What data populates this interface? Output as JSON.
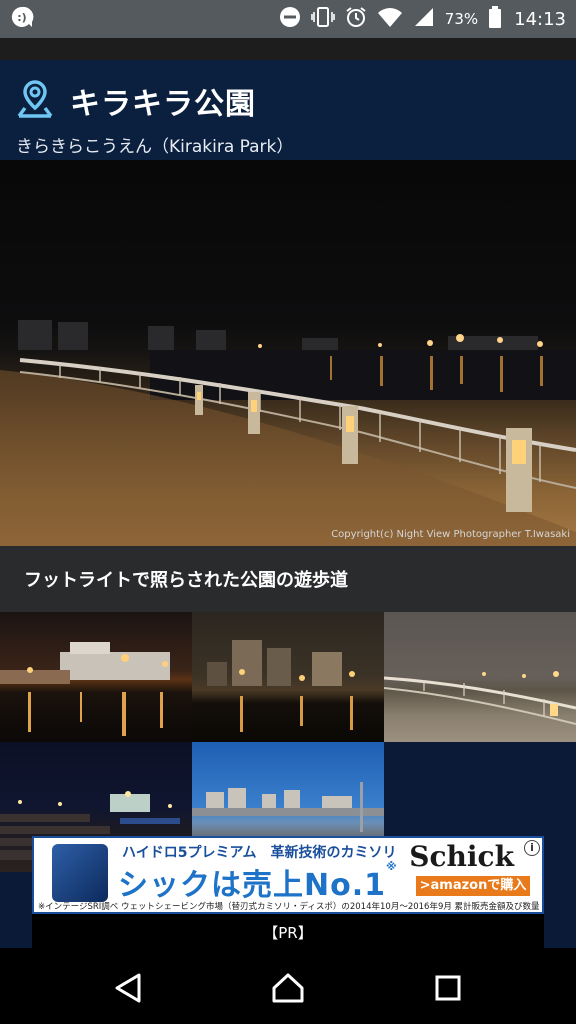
{
  "status_bar": {
    "battery_percent": "73%",
    "time": "14:13",
    "icons": [
      "app-notification-icon",
      "do-not-disturb-icon",
      "vibrate-icon",
      "alarm-icon",
      "wifi-icon",
      "cellular-signal-icon",
      "battery-icon"
    ]
  },
  "header": {
    "title": "キラキラ公園",
    "subtitle": "きらきらこうえん（Kirakira Park）",
    "icon": "location-pin-icon"
  },
  "hero": {
    "credit": "Copyright(c) Night View Photographer T.Iwasaki",
    "caption": "フットライトで照らされた公園の遊歩道"
  },
  "gallery": {
    "thumbnails": [
      "harbor-ship-night",
      "factory-tanks-night",
      "lit-promenade-dusk",
      "terrace-steps-night",
      "industrial-waterfront-day"
    ]
  },
  "ad": {
    "line1": "ハイドロ5プレミアム　革新技術のカミソリ",
    "headline": "シックは売上No.1",
    "headline_mark": "※",
    "brand": "Schick",
    "cta": ">amazonで購入",
    "footnote": "※インテージSRI調べ ウェットシェービング市場（替刃式カミソリ・ディスポ）の2014年10月～2016年9月 累計販売金額及び数量",
    "pr_label": "【PR】"
  },
  "nav": {
    "icons": [
      "back-icon",
      "home-icon",
      "recent-apps-icon"
    ]
  },
  "colors": {
    "header_bg": "#0b1f3f",
    "status_bar_bg": "#555a5f",
    "ad_blue": "#1e73c8",
    "ad_orange": "#e87a1c"
  }
}
